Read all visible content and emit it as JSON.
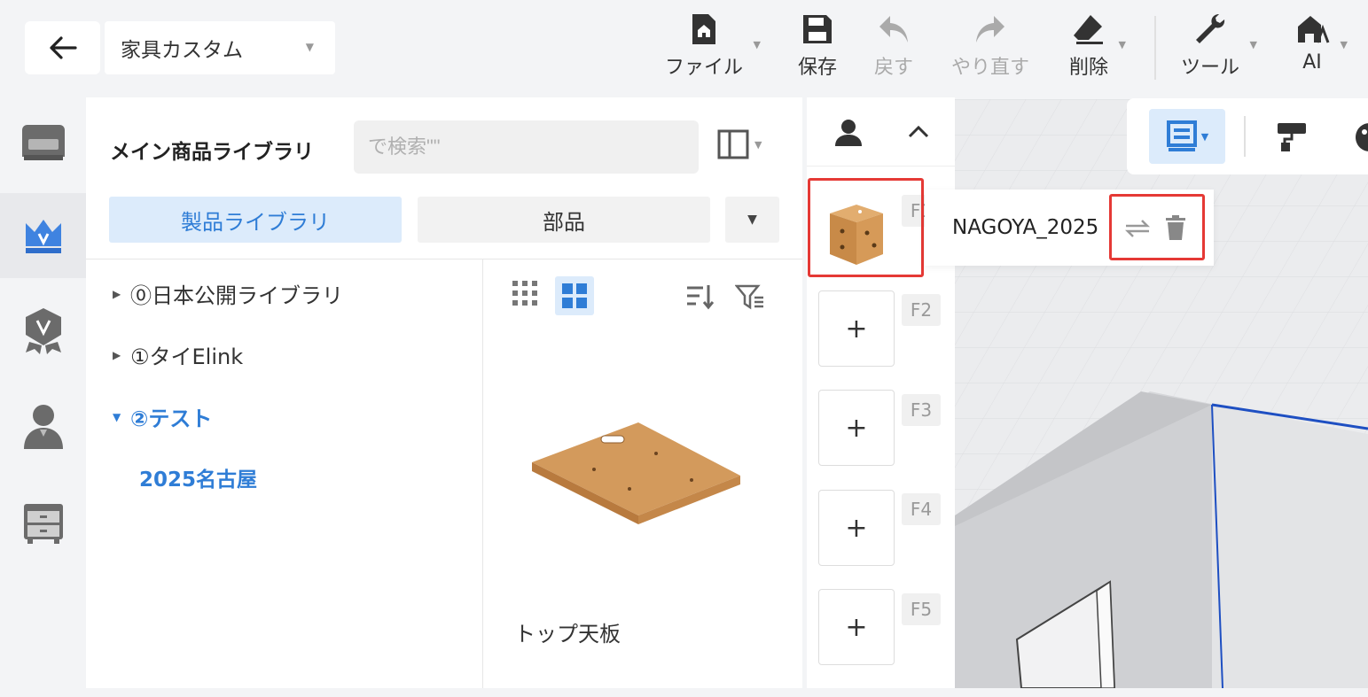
{
  "header": {
    "project_name": "家具カスタム",
    "tools": [
      {
        "label": "ファイル",
        "icon": "file-home-icon"
      },
      {
        "label": "保存",
        "icon": "save-icon"
      },
      {
        "label": "戻す",
        "icon": "undo-icon"
      },
      {
        "label": "やり直す",
        "icon": "redo-icon"
      },
      {
        "label": "削除",
        "icon": "eraser-icon"
      },
      {
        "label": "ツール",
        "icon": "wrench-icon"
      },
      {
        "label": "AI",
        "icon": "ai-house-icon"
      }
    ]
  },
  "sidebar": {
    "items": [
      {
        "icon": "sofa-icon"
      },
      {
        "icon": "crown-icon",
        "active": true
      },
      {
        "icon": "badge-v-icon"
      },
      {
        "icon": "user-icon"
      },
      {
        "icon": "cabinet-icon"
      }
    ]
  },
  "library": {
    "title": "メイン商品ライブラリ",
    "search_placeholder": "で検索\"\"",
    "tabs": [
      "製品ライブラリ",
      "部品"
    ],
    "tree": [
      {
        "label": "⓪日本公開ライブラリ",
        "expanded": false
      },
      {
        "label": "①タイElink",
        "expanded": false
      },
      {
        "label": "②テスト",
        "expanded": true,
        "children": [
          "2025名古屋"
        ]
      }
    ],
    "products": [
      {
        "label": "トップ天板"
      }
    ]
  },
  "floors": {
    "slots": [
      {
        "key": "F1",
        "filled": true
      },
      {
        "key": "F2",
        "filled": false,
        "symbol": "+"
      },
      {
        "key": "F3",
        "filled": false,
        "symbol": "+"
      },
      {
        "key": "F4",
        "filled": false,
        "symbol": "+"
      },
      {
        "key": "F5",
        "filled": false,
        "symbol": "+"
      }
    ],
    "active_name": "NAGOYA_2025"
  },
  "colors": {
    "accent": "#2f7dd6",
    "accent_bg": "#dcebfb",
    "highlight": "#e53935",
    "wood": "#d39a5c"
  }
}
